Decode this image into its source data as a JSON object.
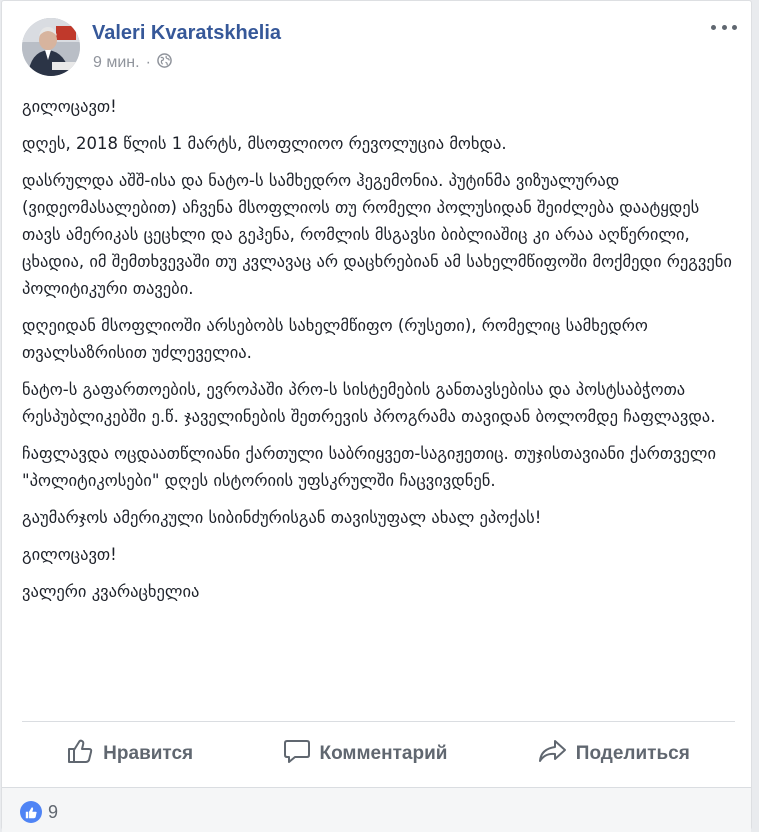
{
  "post": {
    "author": "Valeri Kvaratskhelia",
    "time": "9 мин.",
    "separator": "·",
    "privacy_icon": "globe-icon",
    "paragraphs": [
      "გილოცავთ!",
      "დღეს, 2018 წლის 1 მარტს, მსოფლიოო რევოლუცია მოხდა.",
      "დასრულდა აშშ-ისა და ნატო-ს სამხედრო ჰეგემონია. პუტინმა ვიზუალურად (ვიდეომასალებით) აჩვენა მსოფლიოს თუ რომელი პოლუსიდან შეიძლება დაატყდეს თავს ამერიკას ცეცხლი და გეჰენა, რომლის მსგავსი ბიბლიაშიც კი არაა აღწერილი, ცხადია, იმ შემთხვევაში თუ კვლავაც არ დაცხრებიან ამ სახელმწიფოში მოქმედი რეგვენი პოლიტიკური თავები.",
      "დღეიდან მსოფლიოში არსებობს სახელმწიფო (რუსეთი), რომელიც სამხედრო თვალსაზრისით უძლეველია.",
      "ნატო-ს გაფართოების, ევროპაში პრო-ს სისტემების განთავსებისა და პოსტსაბჭოთა რესპუბლიკებში ე.წ. ჯაველინების შეთრევის პროგრამა თავიდან ბოლომდე ჩაფლავდა.",
      "ჩაფლავდა ოცდაათწლიანი ქართული საბრიყვეთ-საგიჟეთიც. თუჯისთავიანი ქართველი \"პოლიტიკოსები\" დღეს ისტორიის უფსკრულში ჩაცვივდნენ.",
      "გაუმარჯოს ამერიკული სიბინძურისგან თავისუფალ ახალ ეპოქას!",
      "გილოცავთ!",
      "ვალერი კვარაცხელია"
    ]
  },
  "actions": {
    "like": "Нравится",
    "comment": "Комментарий",
    "share": "Поделиться"
  },
  "reactions": {
    "count": "9",
    "icon": "thumbs-up-icon",
    "badge_color": "#4f84f5"
  },
  "colors": {
    "author": "#365899",
    "text": "#1d2129",
    "muted": "#90949c"
  }
}
